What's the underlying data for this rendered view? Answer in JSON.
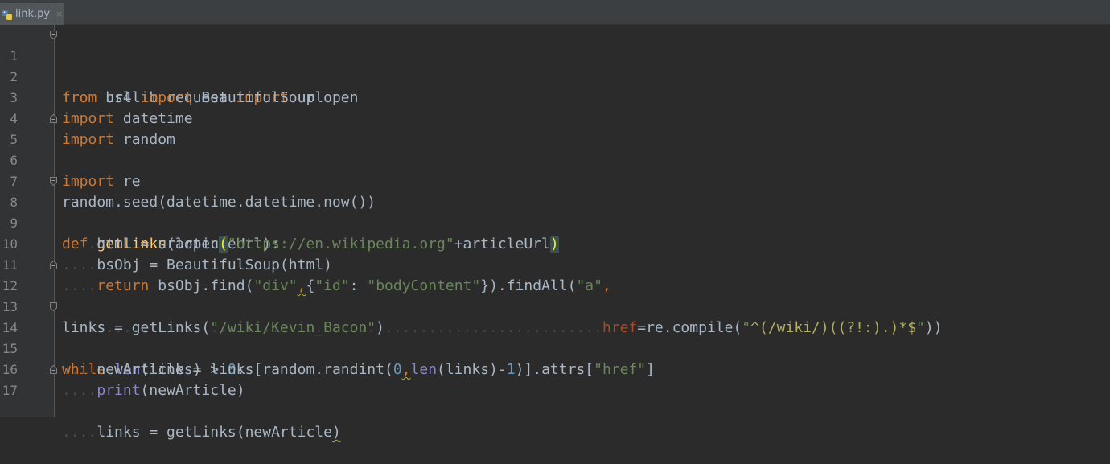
{
  "tab": {
    "label": "link.py",
    "close_glyph": "×",
    "icon": "python-file-icon"
  },
  "colors": {
    "background": "#2b2b2b",
    "keyword": "#cc7832",
    "function": "#ffc66d",
    "string": "#6a8759",
    "number": "#6897bb",
    "builtin": "#8888c6",
    "default": "#a9b7c6"
  },
  "line_numbers": [
    "1",
    "2",
    "3",
    "4",
    "5",
    "6",
    "7",
    "8",
    "9",
    "10",
    "11",
    "12",
    "13",
    "14",
    "15",
    "16",
    "17"
  ],
  "code": {
    "l1": {
      "kw1": "from",
      "t1": " urllib.request ",
      "kw2": "import",
      "t2": " urlopen"
    },
    "l2": {
      "kw1": "from",
      "t1": " bs4 ",
      "kw2": "import",
      "t2": " BeautifulSoup"
    },
    "l3": {
      "kw1": "import",
      "t1": " datetime"
    },
    "l4": {
      "kw1": "import",
      "t1": " random"
    },
    "l5": {
      "kw1": "import",
      "t1": " re"
    },
    "l7": {
      "t1": "random.seed(datetime.datetime.now())"
    },
    "l8": {
      "kw1": "def",
      "sp": " ",
      "fn": "getLinks",
      "t1": "(articleUrl):"
    },
    "l9": {
      "ind": "....",
      "t1": "html = urlopen",
      "p1": "(",
      "s1": "\"https://en.wikipedia.org\"",
      "t2": "+articleUrl",
      "p2": ")"
    },
    "l10": {
      "ind": "....",
      "t1": "bsObj = BeautifulSoup(html)"
    },
    "l11": {
      "ind": "....",
      "kw1": "return",
      "t1": " bsObj.find(",
      "s1": "\"div\"",
      "c1": ",",
      "t2": "{",
      "s2": "\"id\"",
      "t3": ": ",
      "s3": "\"bodyContent\"",
      "t4": "}).findAll(",
      "s4": "\"a\"",
      "t5": ","
    },
    "l12": {
      "ind": "..............................................................",
      "kwa": "href",
      "t1": "=re.compile(",
      "q1": "\"",
      "r1": "^(/wiki/)((?!:).)*$",
      "q2": "\"",
      "t2": "))"
    },
    "l13": {
      "t1": "links = getLinks(",
      "s1": "\"/wiki/Kevin_Bacon\"",
      "t2": ")"
    },
    "l14": {
      "kw1": "while",
      "sp": " ",
      "bi": "len",
      "t1": "(links) > ",
      "n1": "0",
      "t2": ":"
    },
    "l15": {
      "ind": "....",
      "t1": "newArticle = links[random.randint(",
      "n1": "0",
      "c1": ",",
      "bi": "len",
      "t2": "(links)-",
      "n2": "1",
      "t3": ")].attrs[",
      "s1": "\"href\"",
      "t4": "]"
    },
    "l16": {
      "ind": "....",
      "bi": "print",
      "t1": "(newArticle)"
    },
    "l17": {
      "ind": "....",
      "t1": "links = getLinks(newArticle",
      "p1": ")"
    }
  }
}
